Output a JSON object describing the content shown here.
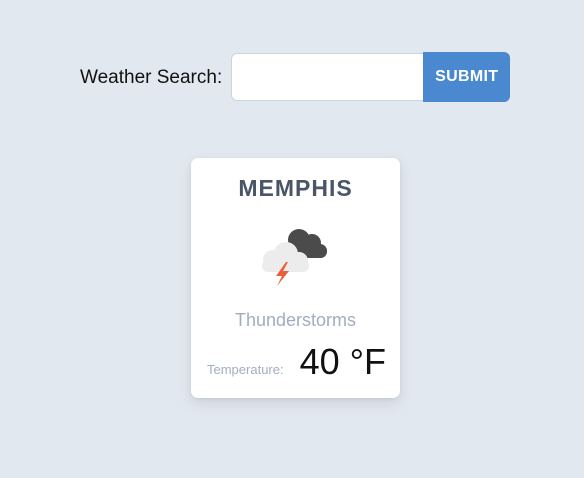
{
  "search": {
    "label": "Weather Search:",
    "value": "",
    "placeholder": "",
    "submit_label": "SUBMIT"
  },
  "card": {
    "city": "MEMPHIS",
    "icon": "thunderstorm-cloud-icon",
    "condition": "Thunderstorms",
    "temperature_label": "Temperature:",
    "temperature_value": "40 °F"
  },
  "colors": {
    "background": "#e2e8f0",
    "accent": "#4a88d0",
    "city_text": "#4a5568",
    "muted_text": "#a0aec0",
    "lightning": "#e8613c"
  }
}
